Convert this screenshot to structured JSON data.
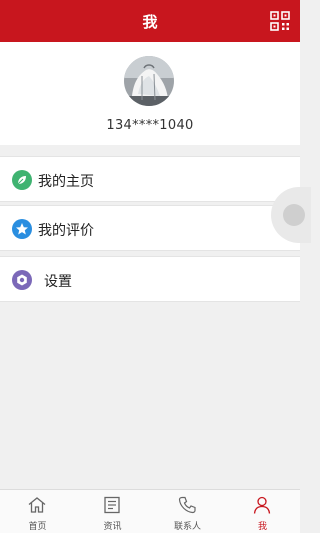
{
  "header": {
    "title": "我",
    "qr_icon": "qr-code-icon"
  },
  "profile": {
    "phone": "134****1040",
    "avatar_icon": "avatar-photo"
  },
  "menu": [
    {
      "label": "我的主页",
      "icon": "leaf-icon",
      "color": "#3fb371"
    },
    {
      "label": "我的评价",
      "icon": "star-icon",
      "color": "#2a8ee0"
    },
    {
      "label": "设置",
      "icon": "gear-icon",
      "color": "#7b68b8"
    }
  ],
  "tabbar": {
    "tabs": [
      {
        "label": "首页",
        "icon": "home-icon"
      },
      {
        "label": "资讯",
        "icon": "news-icon"
      },
      {
        "label": "联系人",
        "icon": "phone-icon"
      },
      {
        "label": "我",
        "icon": "person-icon",
        "active": true
      }
    ]
  },
  "colors": {
    "brand": "#c8161e",
    "background": "#f0f0f0"
  }
}
